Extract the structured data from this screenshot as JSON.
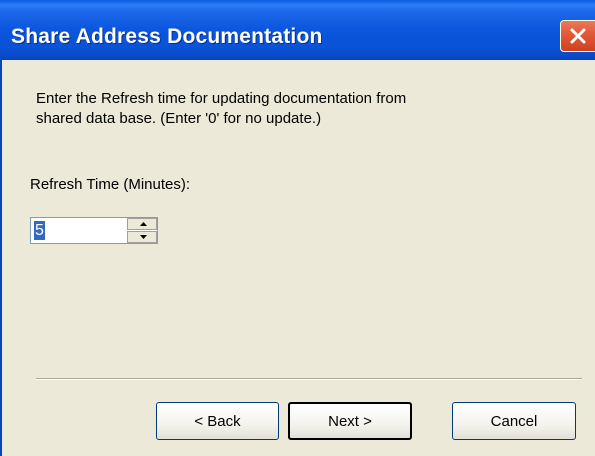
{
  "window": {
    "title": "Share Address Documentation"
  },
  "icons": {
    "close": "close-icon",
    "spin_up": "arrow-up-icon",
    "spin_down": "arrow-down-icon"
  },
  "colors": {
    "titlebar": "#0a52d6",
    "dialog_background": "#ece9d8",
    "close_button": "#e25b3a",
    "selection": "#316ac5"
  },
  "content": {
    "description_line1": "Enter the Refresh time for updating documentation from",
    "description_line2": "shared data base. (Enter '0' for no update.)",
    "refresh_label": "Refresh Time (Minutes):",
    "refresh_value": "5"
  },
  "buttons": {
    "back": "< Back",
    "next": "Next >",
    "cancel": "Cancel"
  }
}
